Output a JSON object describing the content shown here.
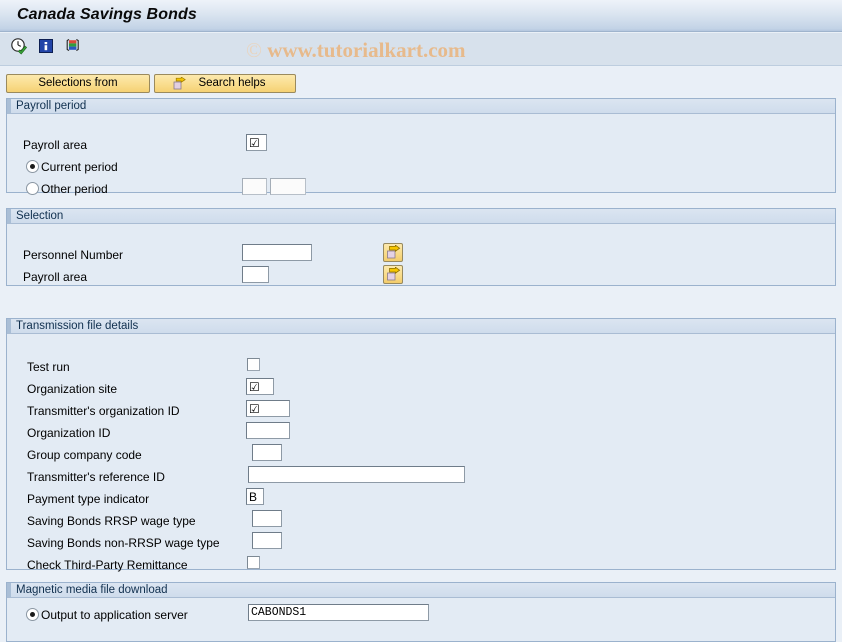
{
  "window": {
    "title": "Canada Savings Bonds"
  },
  "watermark": {
    "copyright": "©",
    "text": "www.tutorialkart.com"
  },
  "toolbar": {
    "icons": [
      {
        "name": "execute-clock-icon",
        "title": "Execute"
      },
      {
        "name": "information-icon",
        "title": "Information"
      },
      {
        "name": "variant-icon",
        "title": "Get Variant"
      }
    ]
  },
  "buttons": {
    "selections_from": "Selections from",
    "search_helps": "Search helps"
  },
  "sections": {
    "payroll_period": {
      "title": "Payroll period",
      "payroll_area_label": "Payroll area",
      "payroll_area_value": "☑",
      "current_period_label": "Current period",
      "other_period_label": "Other period",
      "selected_period": "current",
      "other_period_value_1": "",
      "other_period_value_2": ""
    },
    "selection": {
      "title": "Selection",
      "personnel_number_label": "Personnel Number",
      "personnel_number_value": "",
      "payroll_area_label": "Payroll area",
      "payroll_area_value": "",
      "multi_select_title": "Multiple selection"
    },
    "transmission": {
      "title": "Transmission file details",
      "test_run_label": "Test run",
      "test_run_checked": false,
      "organization_site_label": "Organization site",
      "organization_site_value": "☑",
      "transmitter_org_id_label": "Transmitter's organization ID",
      "transmitter_org_id_value": "☑",
      "organization_id_label": "Organization ID",
      "organization_id_value": "",
      "group_company_code_label": "Group company code",
      "group_company_code_value": "",
      "transmitter_ref_id_label": "Transmitter's reference ID",
      "transmitter_ref_id_value": "",
      "payment_type_indicator_label": "Payment type indicator",
      "payment_type_indicator_value": "B",
      "rrsp_wage_type_label": "Saving Bonds RRSP wage type",
      "rrsp_wage_type_value": "",
      "non_rrsp_wage_type_label": "Saving Bonds non-RRSP wage type",
      "non_rrsp_wage_type_value": "",
      "third_party_remittance_label": "Check Third-Party Remittance",
      "third_party_remittance_checked": false
    },
    "magnetic_media": {
      "title": "Magnetic media file download",
      "output_app_server_label": "Output to application server",
      "output_app_server_selected": true,
      "output_app_server_value": "CABONDS1"
    }
  },
  "colors": {
    "title_bar": "#c3d3e6",
    "toolbar": "#d7e1ec",
    "panel_bg": "#e3ebf4",
    "panel_border": "#9bb2cd",
    "button_yellow": "#f9dd8e",
    "watermark": "#e8b887",
    "page_bg": "#eaf0f7"
  }
}
